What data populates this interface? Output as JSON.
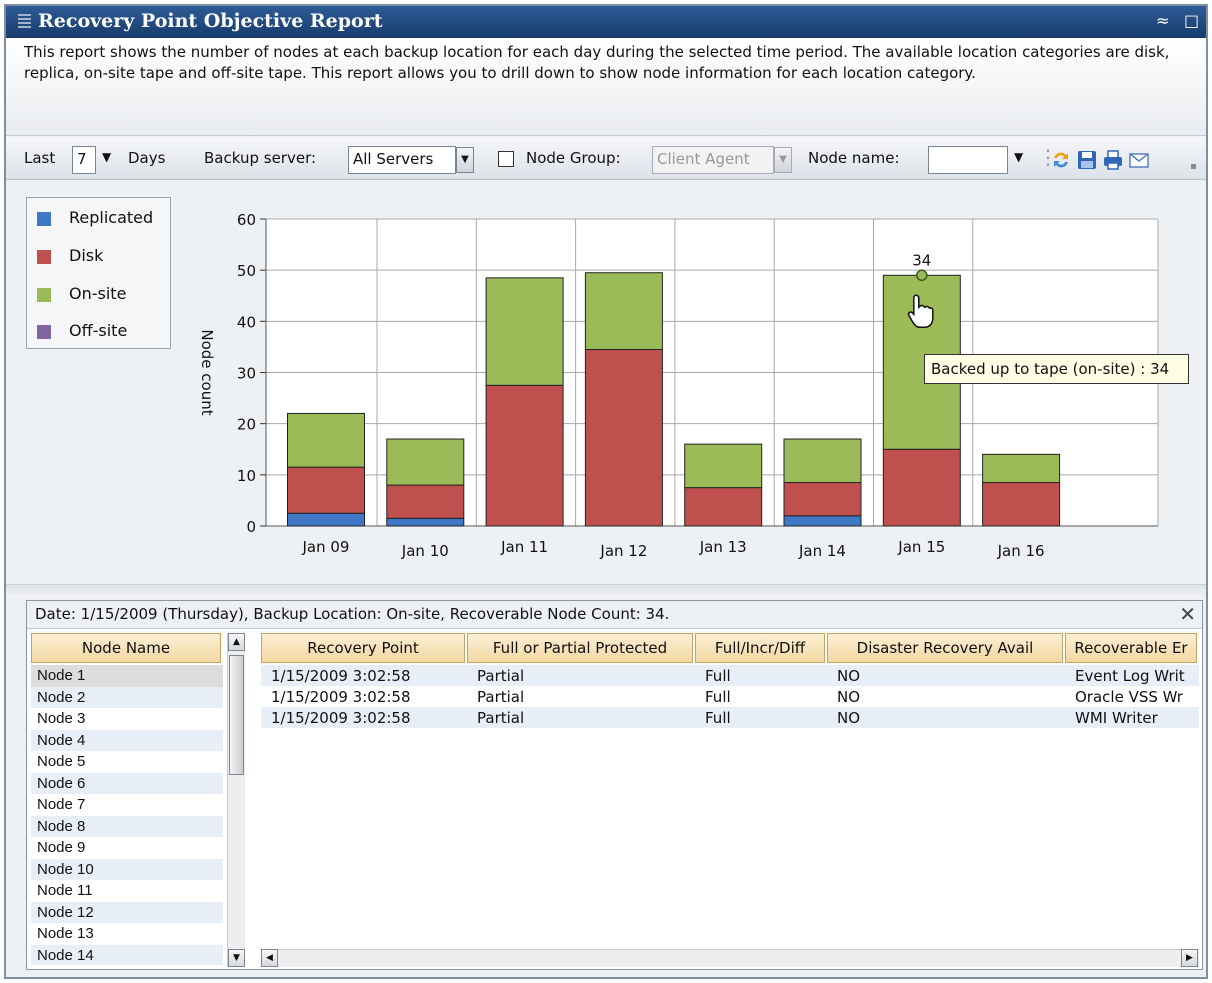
{
  "window": {
    "title": "Recovery Point Objective  Report",
    "description": "This report shows the number of nodes at each backup location for each day during the selected time period. The available location categories are disk, replica, on-site tape and off-site tape. This report allows you to drill down to show node information for each location category."
  },
  "toolbar": {
    "last_label": "Last",
    "last_value": "7",
    "days_label": "Days",
    "backup_server_label": "Backup server:",
    "backup_server_value": "All Servers",
    "node_group_label": "Node Group:",
    "node_group_value": "Client Agent",
    "node_group_checked": false,
    "node_name_label": "Node name:",
    "node_name_value": "",
    "icons": [
      "refresh-icon",
      "save-icon",
      "print-icon",
      "email-icon"
    ]
  },
  "legend": [
    {
      "label": "Replicated",
      "color": "#3f78c6"
    },
    {
      "label": "Disk",
      "color": "#c0504d"
    },
    {
      "label": "On-site",
      "color": "#9bbb59"
    },
    {
      "label": "Off-site",
      "color": "#8064a2"
    }
  ],
  "chart_data": {
    "type": "bar",
    "stacked": true,
    "categories": [
      "Jan 09",
      "Jan 10",
      "Jan 11",
      "Jan 12",
      "Jan 13",
      "Jan 14",
      "Jan 15",
      "Jan 16"
    ],
    "series": [
      {
        "name": "Replicated",
        "color": "#3f78c6",
        "values": [
          2.5,
          1.5,
          0,
          0,
          0,
          2,
          0,
          0
        ]
      },
      {
        "name": "Disk",
        "color": "#c0504d",
        "values": [
          9,
          6.5,
          27.5,
          34.5,
          7.5,
          6.5,
          15,
          8.5
        ]
      },
      {
        "name": "On-site",
        "color": "#9bbb59",
        "values": [
          10.5,
          9,
          21,
          15,
          8.5,
          8.5,
          34,
          5.5
        ]
      },
      {
        "name": "Off-site",
        "color": "#8064a2",
        "values": [
          0,
          0,
          0,
          0,
          0,
          0,
          0,
          0
        ]
      }
    ],
    "ylabel": "Node count",
    "ylim": [
      0,
      60
    ],
    "yticks": [
      0,
      10,
      20,
      30,
      40,
      50,
      60
    ],
    "grid": true,
    "highlight_label": "34",
    "tooltip": "Backed up to tape (on-site) : 34"
  },
  "detail": {
    "info": "Date: 1/15/2009 (Thursday),  Backup Location: On-site, Recoverable Node Count: 34.",
    "node_header": "Node Name",
    "nodes": [
      "Node 1",
      "Node 2",
      "Node 3",
      "Node 4",
      "Node 5",
      "Node 6",
      "Node 7",
      "Node 8",
      "Node 9",
      "Node 10",
      "Node 11",
      "Node 12",
      "Node 13",
      "Node 14"
    ],
    "selected_node": "Node 1",
    "columns": [
      "Recovery Point",
      "Full or Partial Protected",
      "Full/Incr/Diff",
      "Disaster Recovery Avail",
      "Recoverable Er"
    ],
    "rows": [
      [
        "1/15/2009 3:02:58",
        "Partial",
        "Full",
        "NO",
        "Event Log Writ"
      ],
      [
        "1/15/2009 3:02:58",
        "Partial",
        "Full",
        "NO",
        "Oracle VSS Wr"
      ],
      [
        "1/15/2009 3:02:58",
        "Partial",
        "Full",
        "NO",
        "WMI Writer"
      ]
    ]
  }
}
